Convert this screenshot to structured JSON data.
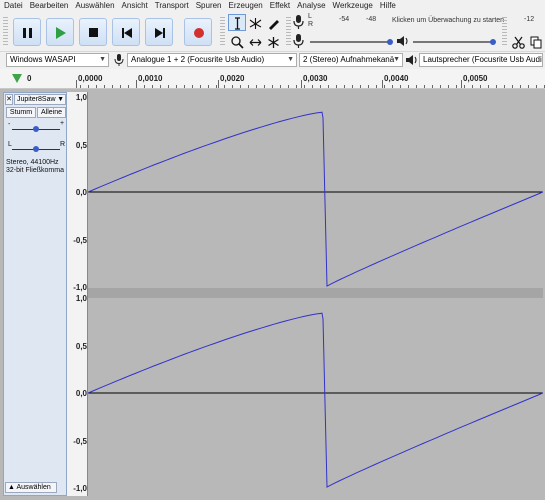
{
  "menu": [
    "Datei",
    "Bearbeiten",
    "Auswählen",
    "Ansicht",
    "Transport",
    "Spuren",
    "Erzeugen",
    "Effekt",
    "Analyse",
    "Werkzeuge",
    "Hilfe"
  ],
  "meter": {
    "lr_top": "L",
    "lr_bottom": "R",
    "ticks": [
      "-54",
      "-48"
    ],
    "click_hint": "Klicken um Überwachung zu starten",
    "tick_right": "-12"
  },
  "devices": {
    "host": "Windows WASAPI",
    "recording_device": "Analogue 1 + 2 (Focusrite Usb Audio)",
    "channels": "2 (Stereo) Aufnahmekanä",
    "playback_device": "Lautsprecher (Focusrite Usb Audio)"
  },
  "ruler": {
    "start": "0",
    "labels": [
      "0,0000",
      "0,0010",
      "0,0020",
      "0,0030",
      "0,0040",
      "0,0050"
    ]
  },
  "track": {
    "name": "Jupiter8Saw",
    "mute": "Stumm",
    "solo": "Alleine",
    "gain_minus": "-",
    "gain_plus": "+",
    "pan_left": "L",
    "pan_right": "R",
    "info_line1": "Stereo, 44100Hz",
    "info_line2": "32-bit Fließkomma",
    "select_label": "Auswählen"
  },
  "vscale": [
    "1,0",
    "0,5",
    "0,0",
    "-0,5",
    "-1,0"
  ],
  "colors": {
    "waveform": "#3232c8",
    "track_bg": "#b8b8b8",
    "play_green": "#2ea043",
    "record_red": "#d32f2f"
  }
}
